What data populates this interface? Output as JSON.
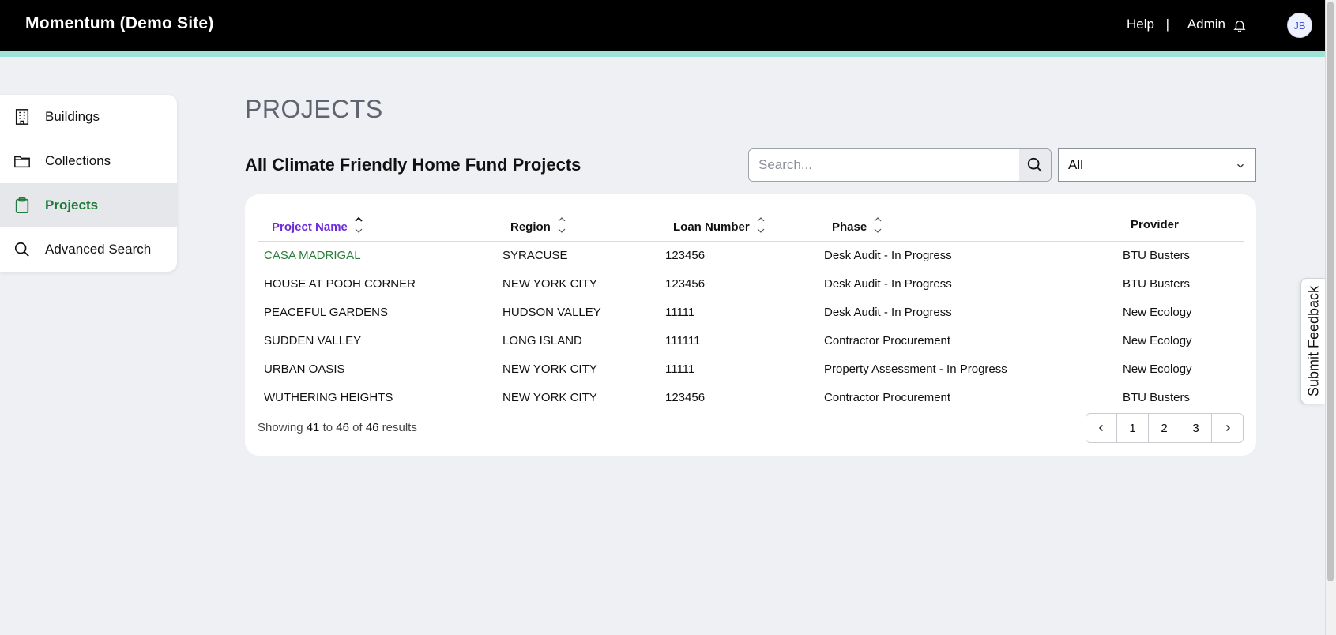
{
  "header": {
    "brand": "Momentum (Demo Site)",
    "help": "Help",
    "separator": "|",
    "admin": "Admin",
    "bell_icon": "bell-icon",
    "avatar_initials": "JB"
  },
  "colors": {
    "header_bg": "#000000",
    "accent_bar": "#9fe3d8",
    "active_nav_text": "#1f7a3a",
    "sorted_header": "#6b2bd9",
    "row_link": "#2a7d3a"
  },
  "sidebar": {
    "items": [
      {
        "label": "Buildings",
        "icon": "building-icon",
        "active": false
      },
      {
        "label": "Collections",
        "icon": "folder-icon",
        "active": false
      },
      {
        "label": "Projects",
        "icon": "clipboard-icon",
        "active": true
      },
      {
        "label": "Advanced Search",
        "icon": "search-icon",
        "active": false
      }
    ]
  },
  "main": {
    "page_title": "PROJECTS",
    "section_title": "All Climate Friendly Home Fund Projects",
    "search": {
      "placeholder": "Search...",
      "value": ""
    },
    "filter": {
      "selected": "All"
    }
  },
  "table": {
    "columns": [
      "Project Name",
      "Region",
      "Loan Number",
      "Phase",
      "Provider"
    ],
    "sorted_column": "Project Name",
    "rows": [
      [
        "CASA MADRIGAL",
        "SYRACUSE",
        "123456",
        "Desk Audit - In Progress",
        "BTU Busters"
      ],
      [
        "HOUSE AT POOH CORNER",
        "NEW YORK CITY",
        "123456",
        "Desk Audit - In Progress",
        "BTU Busters"
      ],
      [
        "PEACEFUL GARDENS",
        "HUDSON VALLEY",
        "11111",
        "Desk Audit - In Progress",
        "New Ecology"
      ],
      [
        "SUDDEN VALLEY",
        "LONG ISLAND",
        "111111",
        "Contractor Procurement",
        "New Ecology"
      ],
      [
        "URBAN OASIS",
        "NEW YORK CITY",
        "11111",
        "Property Assessment - In Progress",
        "New Ecology"
      ],
      [
        "WUTHERING HEIGHTS",
        "NEW YORK CITY",
        "123456",
        "Contractor Procurement",
        "BTU Busters"
      ]
    ]
  },
  "pagination": {
    "showing_prefix": "Showing",
    "from": "41",
    "to_word": "to",
    "to": "46",
    "of_word": "of",
    "total": "46",
    "results_word": "results",
    "prev_icon": "chevron-left-icon",
    "next_icon": "chevron-right-icon",
    "pages": [
      "1",
      "2",
      "3"
    ]
  },
  "feedback": {
    "label": "Submit Feedback"
  }
}
